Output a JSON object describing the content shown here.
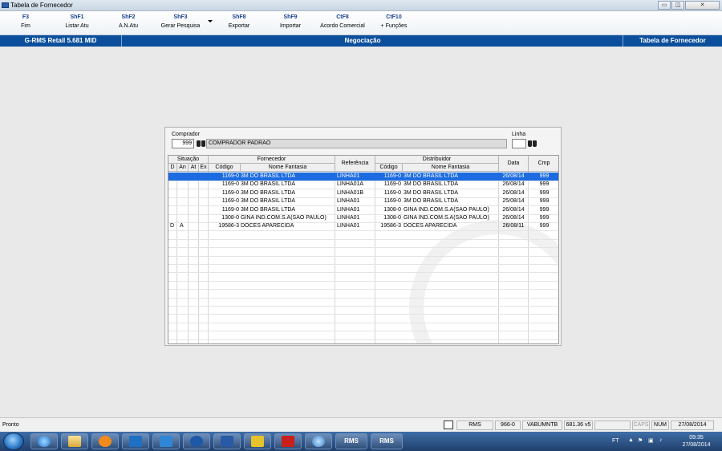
{
  "window": {
    "title": "Tabela de Fornecedor",
    "min_glyph": "▭",
    "max_glyph": "◫",
    "close_glyph": "✕"
  },
  "toolbar": {
    "buttons": [
      {
        "key": "F3",
        "label": "Fim"
      },
      {
        "key": "ShF1",
        "label": "Listar Atu"
      },
      {
        "key": "ShF2",
        "label": "A.N.Atu"
      },
      {
        "key": "ShF3",
        "label": "Gerar Pesquisa"
      },
      {
        "key": "ShF8",
        "label": "Exportar"
      },
      {
        "key": "ShF9",
        "label": "Importar"
      },
      {
        "key": "CtF8",
        "label": "Acordo Comercial"
      },
      {
        "key": "CtF10",
        "label": "+ Funções"
      }
    ]
  },
  "banner": {
    "left": "G-RMS Retail 5.681 MID",
    "center": "Negociação",
    "right": "Tabela de Fornecedor"
  },
  "form": {
    "comprador_label": "Comprador",
    "comprador_code": "999",
    "comprador_name": "COMPRADOR PADRAO",
    "linha_label": "Linha"
  },
  "grid": {
    "group_headers": {
      "situacao": "Situação",
      "fornecedor": "Fornecedor",
      "referencia": "Referência",
      "distribuidor": "Distribuidor",
      "data": "Data",
      "cmp": "Cmp"
    },
    "sub_headers": {
      "d": "D",
      "an": "An",
      "at": "At",
      "ex": "Ex",
      "forn_codigo": "Código",
      "forn_nome": "Nome Fantasia",
      "dist_codigo": "Código",
      "dist_nome": "Nome Fantasia"
    },
    "rows": [
      {
        "d": "",
        "an": "",
        "at": "",
        "ex": "",
        "forn_codigo": "1169-0",
        "forn_nome": "3M DO BRASIL LTDA",
        "referencia": "LINHA01",
        "dist_codigo": "1169-0",
        "dist_nome": "3M DO BRASIL LTDA",
        "data": "26/08/14",
        "cmp": "999",
        "selected": true
      },
      {
        "d": "",
        "an": "",
        "at": "",
        "ex": "",
        "forn_codigo": "1169-0",
        "forn_nome": "3M DO BRASIL LTDA",
        "referencia": "LINHA01A",
        "dist_codigo": "1169-0",
        "dist_nome": "3M DO BRASIL LTDA",
        "data": "26/08/14",
        "cmp": "999"
      },
      {
        "d": "",
        "an": "",
        "at": "",
        "ex": "",
        "forn_codigo": "1169-0",
        "forn_nome": "3M DO BRASIL LTDA",
        "referencia": "LINHA01B",
        "dist_codigo": "1169-0",
        "dist_nome": "3M DO BRASIL LTDA",
        "data": "26/08/14",
        "cmp": "999"
      },
      {
        "d": "",
        "an": "",
        "at": "",
        "ex": "",
        "forn_codigo": "1169-0",
        "forn_nome": "3M DO BRASIL LTDA",
        "referencia": "LINHA01",
        "dist_codigo": "1169-0",
        "dist_nome": "3M DO BRASIL LTDA",
        "data": "25/08/14",
        "cmp": "999"
      },
      {
        "d": "",
        "an": "",
        "at": "",
        "ex": "",
        "forn_codigo": "1169-0",
        "forn_nome": "3M DO BRASIL LTDA",
        "referencia": "LINHA01",
        "dist_codigo": "1308-0",
        "dist_nome": "GINA IND.COM.S.A(SAO PAULO)",
        "data": "26/08/14",
        "cmp": "999"
      },
      {
        "d": "",
        "an": "",
        "at": "",
        "ex": "",
        "forn_codigo": "1308-0",
        "forn_nome": "GINA IND.COM.S.A(SAO PAULO)",
        "referencia": "LINHA01",
        "dist_codigo": "1308-0",
        "dist_nome": "GINA IND.COM.S.A(SAO PAULO)",
        "data": "26/08/14",
        "cmp": "999"
      },
      {
        "d": "D",
        "an": "A",
        "at": "",
        "ex": "",
        "forn_codigo": "19586-3",
        "forn_nome": "DOCES APARECIDA",
        "referencia": "LINHA01",
        "dist_codigo": "19586-3",
        "dist_nome": "DOCES APARECIDA",
        "data": "26/08/11",
        "cmp": "999"
      }
    ]
  },
  "status": {
    "left": "Pronto",
    "cells": [
      "RMS",
      "966-0",
      "VABUMNTB",
      "681.36 v5",
      "",
      "CAPS",
      "NUM",
      "27/08/2014"
    ]
  },
  "taskbar": {
    "apps": [
      "start-orb",
      "internet-explorer",
      "file-explorer",
      "media-player",
      "outlook",
      "lync",
      "teamviewer",
      "word",
      "database-tool",
      "acrobat",
      "globe-app",
      "rms-1",
      "rms-2"
    ],
    "rms_label": "RMS",
    "tray_lang": "FT",
    "time": "09:35",
    "date": "27/08/2014"
  }
}
